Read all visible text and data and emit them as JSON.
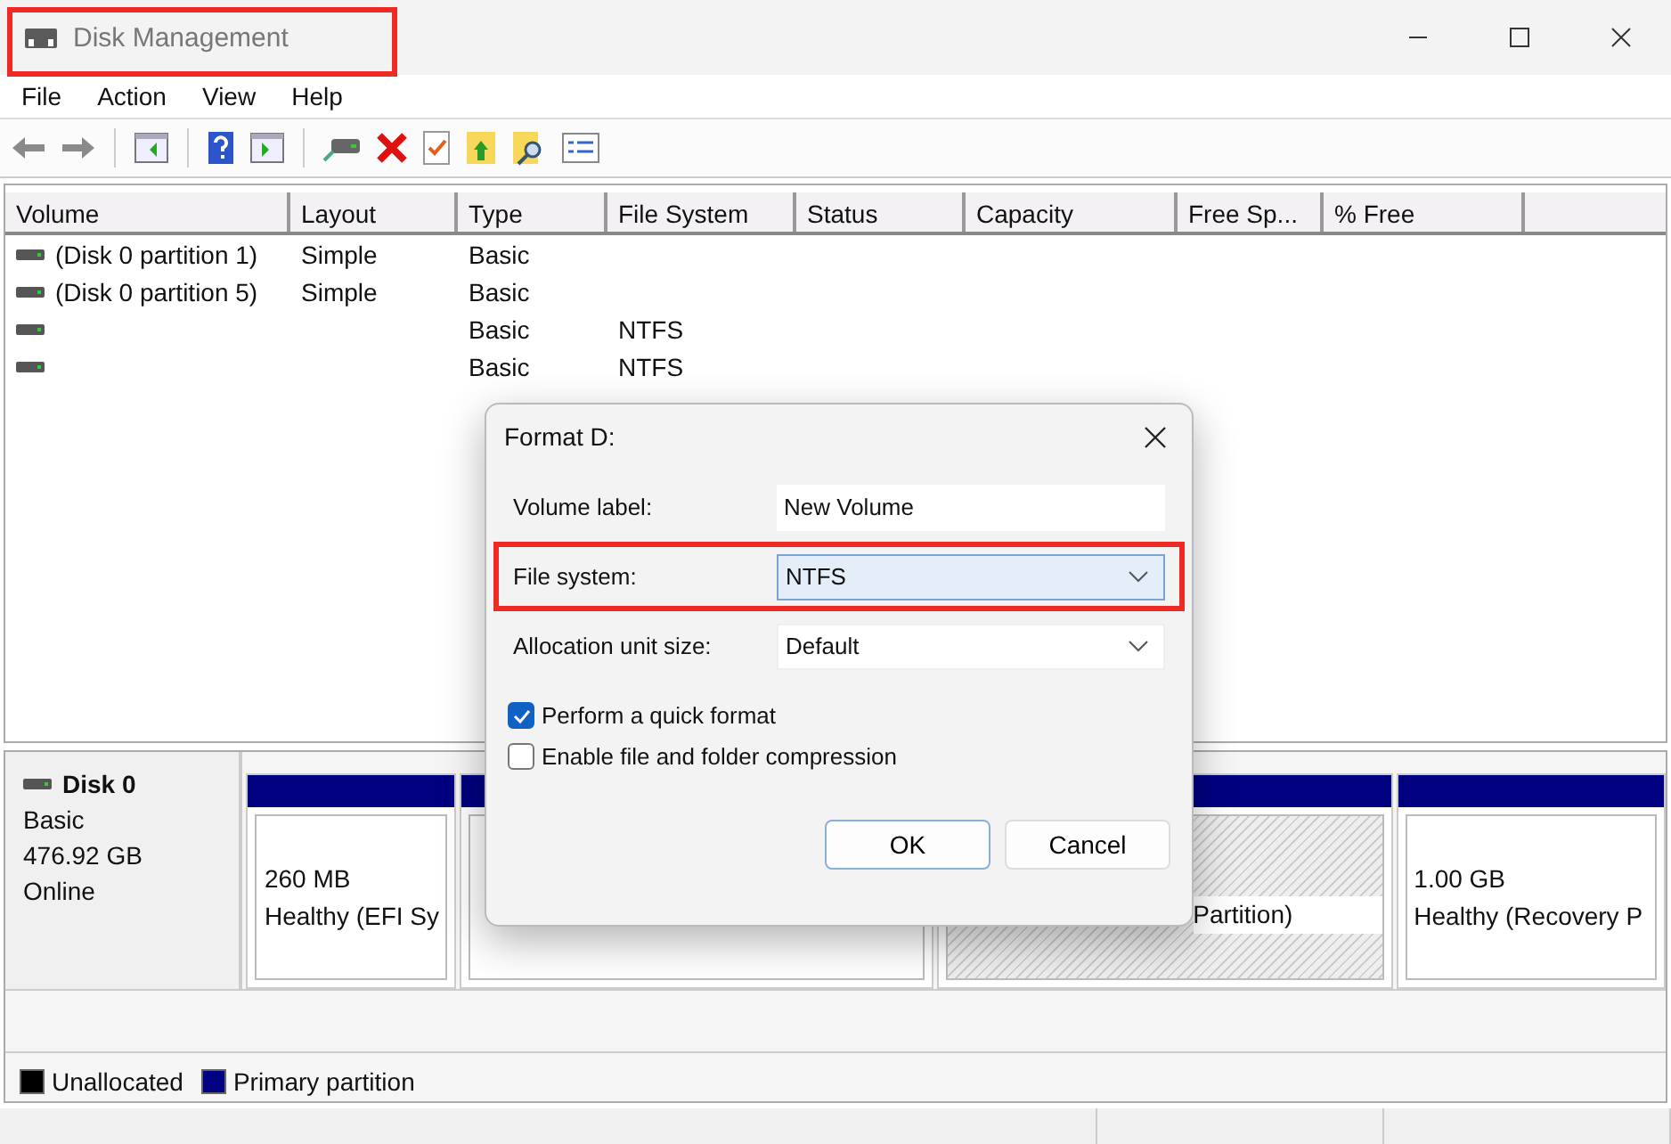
{
  "window": {
    "title": "Disk Management",
    "highlighted": true
  },
  "menu": [
    "File",
    "Action",
    "View",
    "Help"
  ],
  "toolbar": [
    {
      "kind": "back"
    },
    {
      "kind": "forward"
    },
    {
      "kind": "sep"
    },
    {
      "kind": "tree"
    },
    {
      "kind": "sep"
    },
    {
      "kind": "help"
    },
    {
      "kind": "pane"
    },
    {
      "kind": "sep"
    },
    {
      "kind": "drive"
    },
    {
      "kind": "delete"
    },
    {
      "kind": "check"
    },
    {
      "kind": "folderup"
    },
    {
      "kind": "foldersearch"
    },
    {
      "kind": "props"
    }
  ],
  "table": {
    "columns": [
      "Volume",
      "Layout",
      "Type",
      "File System",
      "Status",
      "Capacity",
      "Free Sp...",
      "% Free"
    ],
    "rows": [
      {
        "volume": "(Disk 0 partition 1)",
        "layout": "Simple",
        "type": "Basic",
        "fs": ""
      },
      {
        "volume": "(Disk 0 partition 5)",
        "layout": "Simple",
        "type": "Basic",
        "fs": ""
      },
      {
        "volume": "",
        "layout": "",
        "type": "Basic",
        "fs": "NTFS"
      },
      {
        "volume": "",
        "layout": "",
        "type": "Basic",
        "fs": "NTFS"
      }
    ]
  },
  "disk": {
    "name": "Disk 0",
    "type": "Basic",
    "size": "476.92 GB",
    "status": "Online",
    "partitions": [
      {
        "kind": "primary",
        "lines": [
          "260 MB",
          "Healthy (EFI Sy"
        ]
      },
      {
        "kind": "primary"
      },
      {
        "kind": "hatched",
        "lines": [
          "Partition)"
        ]
      },
      {
        "kind": "primary",
        "lines": [
          "1.00 GB",
          "Healthy (Recovery P"
        ]
      }
    ]
  },
  "legend": [
    {
      "label": "Unallocated",
      "color": "#000000"
    },
    {
      "label": "Primary partition",
      "color": "#000080"
    }
  ],
  "dialog": {
    "title": "Format D:",
    "fields": [
      {
        "kind": "text",
        "label": "Volume label:",
        "value": "New Volume",
        "highlighted": false
      },
      {
        "kind": "select",
        "label": "File system:",
        "value": "NTFS",
        "highlighted": true
      },
      {
        "kind": "select",
        "label": "Allocation unit size:",
        "value": "Default",
        "highlighted": false
      }
    ],
    "options": [
      {
        "label": "Perform a quick format",
        "checked": true
      },
      {
        "label": "Enable file and folder compression",
        "checked": false
      }
    ],
    "buttons": [
      {
        "label": "OK",
        "default": true
      },
      {
        "label": "Cancel",
        "default": false
      }
    ]
  }
}
